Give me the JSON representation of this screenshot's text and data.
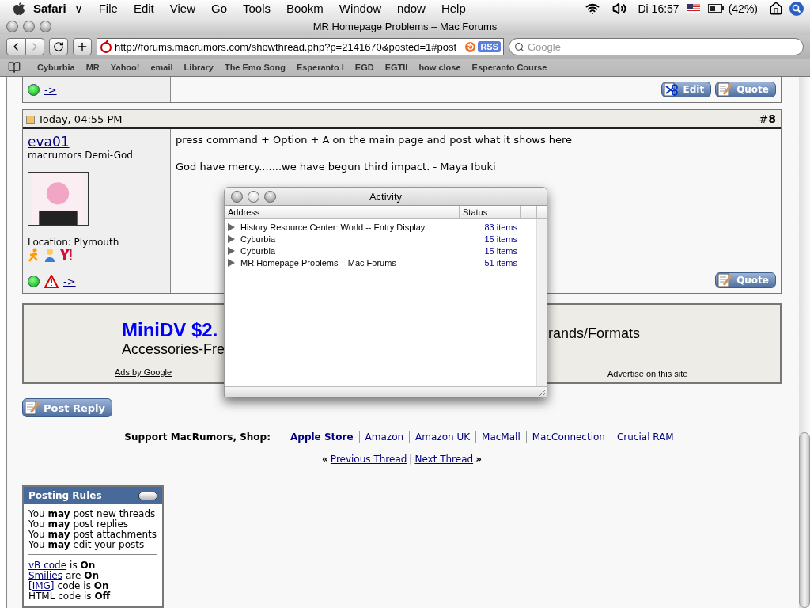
{
  "menu_bar": {
    "app": "Safari",
    "app_mark": "∨",
    "items": [
      "File",
      "Edit",
      "View",
      "Go",
      "Tools",
      "Bookm",
      "Window",
      "ndow",
      "Help"
    ],
    "clock": "Di 16:57",
    "battery": "(42%)"
  },
  "window": {
    "title": "MR Homepage Problems – Mac Forums"
  },
  "toolbar": {
    "url": "http://forums.macrumors.com/showthread.php?p=2141670&posted=1#post",
    "rss": "RSS",
    "search_placeholder": "Google"
  },
  "bookmarks": [
    "Cyburbia",
    "MR",
    "Yahoo!",
    "email",
    "Library",
    "The Emo Song",
    "Esperanto I",
    "EGD",
    "EGTII",
    "how close",
    "Esperanto Course"
  ],
  "previous_post": {
    "link": "->",
    "buttons": [
      {
        "kind": "edit",
        "label": "Edit"
      },
      {
        "kind": "quote",
        "label": "Quote"
      }
    ]
  },
  "post": {
    "date": "Today, 04:55 PM",
    "number": "#**8**",
    "username": "eva01",
    "rank": "macrumors Demi-God",
    "location": "Location: Plymouth",
    "link": "->",
    "message": "press command + Option + A on the main page and post what it shows here",
    "signature": "God have mercy.......we have begun third impact. - Maya Ibuki",
    "buttons": [
      {
        "kind": "quote",
        "label": "Quote"
      }
    ]
  },
  "ad": {
    "headline": "MiniDV $2.",
    "line": "Accessories-Fre",
    "right_text": "rands/Formats",
    "ads_by": "Ads by Google",
    "advertise": "Advertise on this site"
  },
  "post_reply": "Post Reply",
  "shop": {
    "label": "Support MacRumors, Shop:",
    "links": [
      {
        "label": "Apple Store",
        "emphasized": true
      },
      {
        "label": "Amazon",
        "emphasized": false
      },
      {
        "label": "Amazon UK",
        "emphasized": false
      },
      {
        "label": "MacMall",
        "emphasized": false
      },
      {
        "label": "MacConnection",
        "emphasized": false
      },
      {
        "label": "Crucial RAM",
        "emphasized": false
      }
    ]
  },
  "thread_nav": {
    "open": "«",
    "previous": "Previous Thread",
    "separator": "|",
    "next": "Next Thread",
    "close": "»"
  },
  "posting_rules": {
    "title": "Posting Rules",
    "permissions": [
      "You **may** post new threads",
      "You **may** post replies",
      "You **may** post attachments",
      "You **may** edit your posts"
    ],
    "settings": [
      {
        "link": "vB code",
        "text": "is **On**"
      },
      {
        "link": "Smilies",
        "text": "are **On**"
      },
      {
        "link": "[IMG]",
        "text": "code is **On**"
      },
      {
        "text": "HTML code is **Off**"
      }
    ]
  },
  "activity": {
    "title": "Activity",
    "columns": [
      "Address",
      "Status"
    ],
    "rows": [
      {
        "address": "History Resource Center: World -- Entry Display",
        "status": "83 items",
        "expanded": false
      },
      {
        "address": "Cyburbia",
        "status": "15 items",
        "expanded": false
      },
      {
        "address": "Cyburbia",
        "status": "15 items",
        "expanded": false
      },
      {
        "address": "MR Homepage Problems – Mac Forums",
        "status": "51 items",
        "expanded": false
      }
    ]
  }
}
